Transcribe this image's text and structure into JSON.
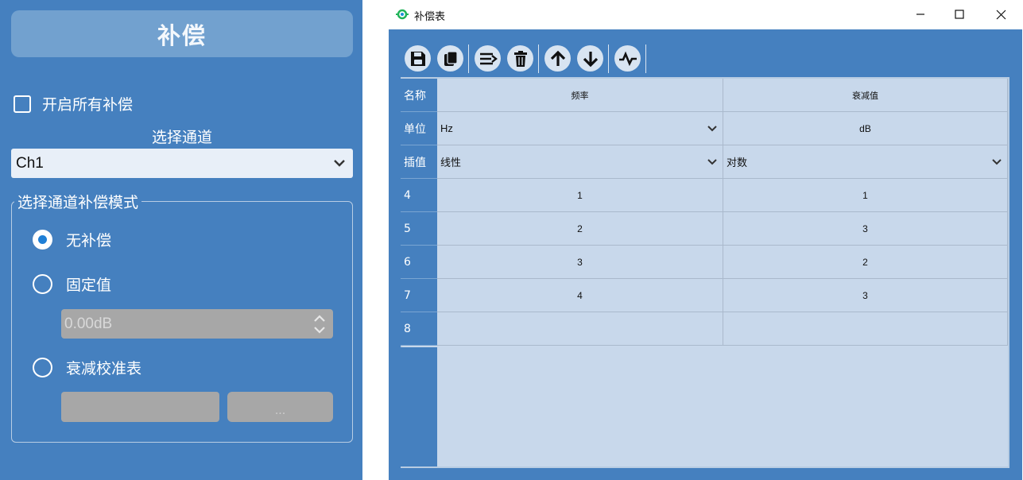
{
  "left_panel": {
    "header": "补偿",
    "enable_all_label": "开启所有补偿",
    "channel_title": "选择通道",
    "channel_selected": "Ch1",
    "mode_group_title": "选择通道补偿模式",
    "modes": [
      {
        "label": "无补偿",
        "checked": true
      },
      {
        "label": "固定值",
        "checked": false
      },
      {
        "label": "衰减校准表",
        "checked": false
      }
    ],
    "fixed_value": "0.00dB",
    "browse_label": "..."
  },
  "window": {
    "title": "补偿表",
    "controls": [
      "minimize-icon",
      "maximize-icon",
      "close-icon"
    ],
    "toolbar": [
      "save-icon",
      "copy-icon",
      "insert-rows-icon",
      "delete-icon",
      "arrow-up-icon",
      "arrow-down-icon",
      "waveform-icon"
    ]
  },
  "table": {
    "row_headers": [
      "名称",
      "单位",
      "插值",
      "4",
      "5",
      "6",
      "7",
      "8"
    ],
    "name_row": [
      "频率",
      "衰减值"
    ],
    "unit_row": [
      "Hz",
      "dB"
    ],
    "interp_row": [
      "线性",
      "对数"
    ],
    "data_rows": [
      [
        "1",
        "1"
      ],
      [
        "2",
        "3"
      ],
      [
        "3",
        "2"
      ],
      [
        "4",
        "3"
      ],
      [
        "",
        ""
      ]
    ]
  },
  "colors": {
    "panel_blue": "#4580bf",
    "cell_bg": "#c8d8eb",
    "radio_accent": "#1f7fd6"
  }
}
